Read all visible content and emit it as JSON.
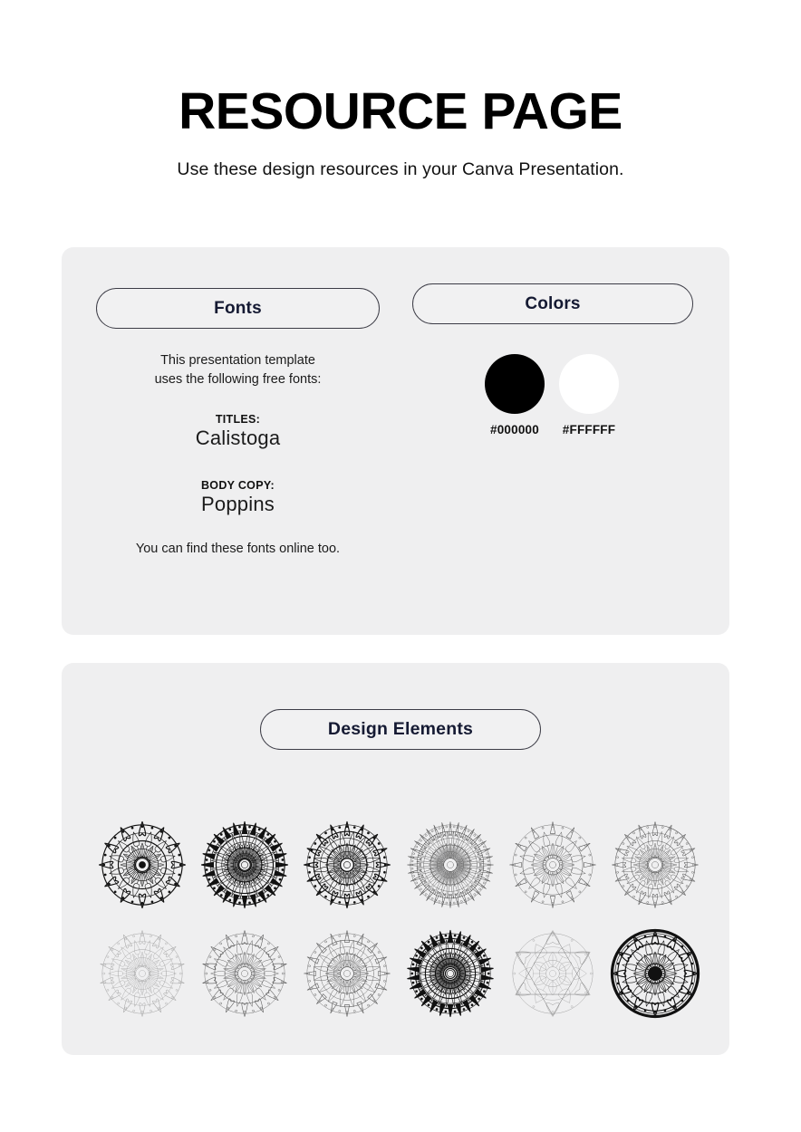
{
  "header": {
    "title": "RESOURCE PAGE",
    "subtitle": "Use these design resources in your Canva Presentation."
  },
  "fonts_section": {
    "heading": "Fonts",
    "intro_line1": "This presentation template",
    "intro_line2": "uses the following free fonts:",
    "titles_label": "TITLES:",
    "titles_font": "Calistoga",
    "body_label": "BODY COPY:",
    "body_font": "Poppins",
    "footer_note": "You can find these fonts online too."
  },
  "colors_section": {
    "heading": "Colors",
    "swatches": [
      {
        "hex": "#000000",
        "label": "#000000"
      },
      {
        "hex": "#FFFFFF",
        "label": "#FFFFFF"
      }
    ]
  },
  "design_section": {
    "heading": "Design Elements",
    "elements": [
      {
        "name": "mandala-floral-bold",
        "style": "bold",
        "petals": 12,
        "rings": 5
      },
      {
        "name": "mandala-scale-spiral",
        "style": "bold",
        "petals": 24,
        "rings": 7
      },
      {
        "name": "mandala-ornate-medallion",
        "style": "bold",
        "petals": 16,
        "rings": 6
      },
      {
        "name": "mandala-lace-circle",
        "style": "light",
        "petals": 32,
        "rings": 6
      },
      {
        "name": "mandala-starburst",
        "style": "light",
        "petals": 12,
        "rings": 4
      },
      {
        "name": "mandala-leaf-bloom",
        "style": "light",
        "petals": 16,
        "rings": 5
      },
      {
        "name": "mandala-soft-petal",
        "style": "faint",
        "petals": 14,
        "rings": 5
      },
      {
        "name": "mandala-ringed-rosette",
        "style": "light",
        "petals": 14,
        "rings": 4
      },
      {
        "name": "mandala-spiked-wave",
        "style": "light",
        "petals": 16,
        "rings": 6
      },
      {
        "name": "mandala-dense-scales",
        "style": "bold",
        "petals": 26,
        "rings": 8
      },
      {
        "name": "mandala-hexagram",
        "style": "faint",
        "petals": 6,
        "rings": 3
      },
      {
        "name": "mandala-dark-ring-lotus",
        "style": "bold",
        "petals": 12,
        "rings": 4
      }
    ]
  },
  "theme": {
    "page_background": "#FFFFFF",
    "panel_background": "#EFEFF0",
    "pill_border": "#3C3C46",
    "pill_text": "#151A33",
    "text_color": "#1B1B1B",
    "title_color": "#000000"
  }
}
